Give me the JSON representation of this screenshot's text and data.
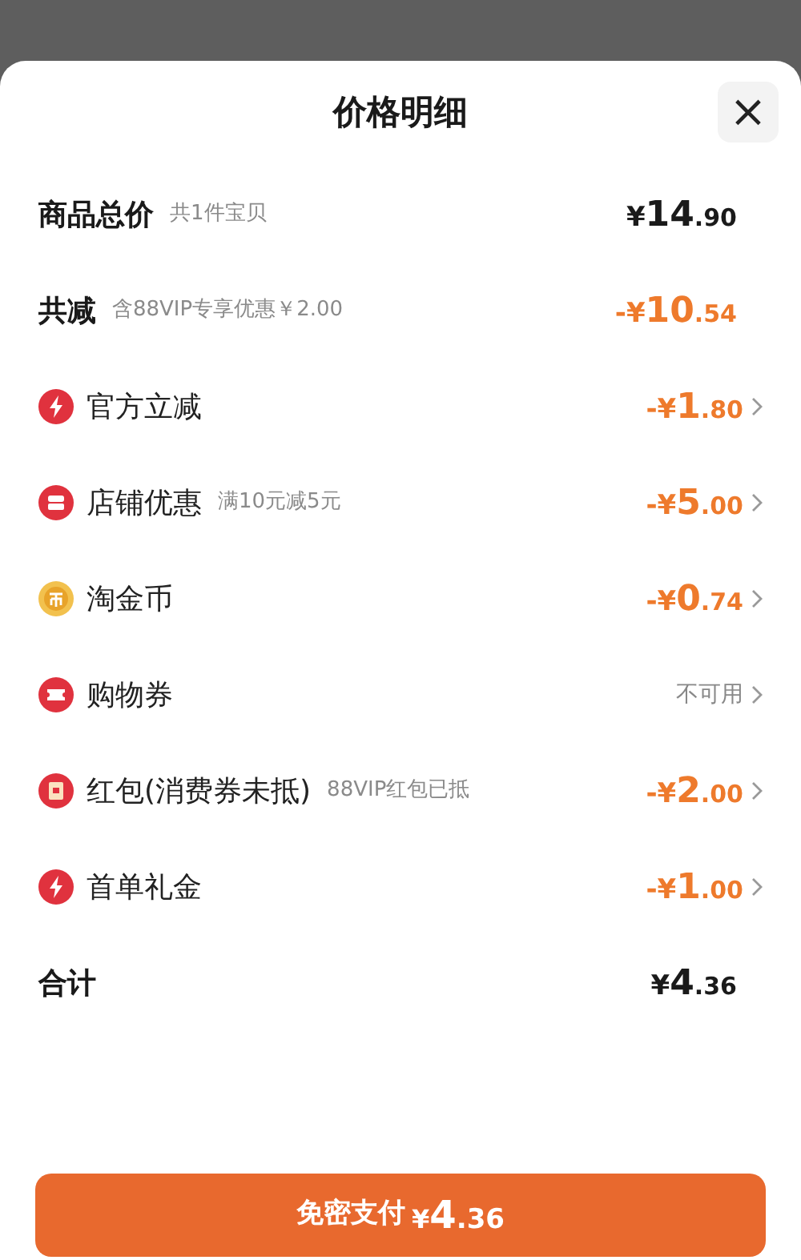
{
  "sheet": {
    "title": "价格明细",
    "close": "×"
  },
  "rows": [
    {
      "kind": "subtotal",
      "label": "商品总价",
      "note": "共1件宝贝",
      "value": {
        "kind": "amount",
        "prefix": "¥",
        "main": "14",
        "fraction": ".90"
      },
      "chevron": false
    },
    {
      "kind": "discount_total",
      "label": "共减",
      "note": "含88VIP专享优惠￥2.00",
      "value": {
        "kind": "amount",
        "prefix": "-¥",
        "main": "10",
        "fraction": ".54"
      },
      "chevron": false
    },
    {
      "kind": "discount",
      "label": "官方立减",
      "value": {
        "kind": "amount",
        "prefix": "-¥",
        "main": "1",
        "fraction": ".80"
      },
      "chevron": true
    },
    {
      "kind": "discount",
      "label": "店铺优惠",
      "note": "满10元减5元",
      "value": {
        "kind": "amount",
        "prefix": "-¥",
        "main": "5",
        "fraction": ".00"
      },
      "chevron": true
    },
    {
      "kind": "discount",
      "label": "淘金币",
      "value": {
        "kind": "amount",
        "prefix": "-¥",
        "main": "0",
        "fraction": ".74"
      },
      "chevron": true
    },
    {
      "kind": "discount",
      "label": "购物券",
      "value": {
        "kind": "text",
        "text": "不可用"
      },
      "chevron": true
    },
    {
      "kind": "discount",
      "label": "红包(消费券未抵)",
      "note": "88VIP红包已抵",
      "value": {
        "kind": "amount",
        "prefix": "-¥",
        "main": "2",
        "fraction": ".00"
      },
      "chevron": true
    },
    {
      "kind": "discount",
      "label": "首单礼金",
      "value": {
        "kind": "amount",
        "prefix": "-¥",
        "main": "1",
        "fraction": ".00"
      },
      "chevron": true
    },
    {
      "kind": "total",
      "label": "合计",
      "value": {
        "kind": "amount",
        "prefix": "¥",
        "main": "4",
        "fraction": ".36"
      },
      "chevron": false
    }
  ],
  "pay_button": {
    "label": "免密支付",
    "prefix": "¥",
    "main": "4",
    "fraction": ".36"
  }
}
